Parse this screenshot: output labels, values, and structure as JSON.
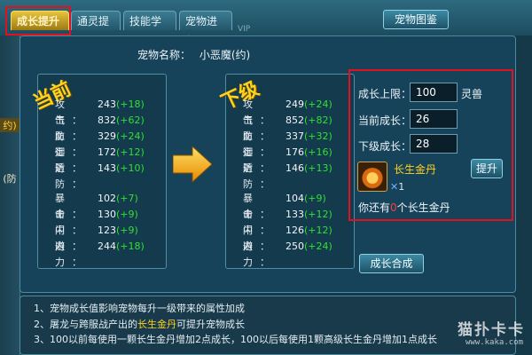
{
  "tabs": [
    {
      "label": "成长提升",
      "active": true
    },
    {
      "label": "通灵提升",
      "active": false
    },
    {
      "label": "技能学习",
      "active": false
    },
    {
      "label": "宠物进化",
      "active": false
    }
  ],
  "header": {
    "atlas_button": "宠物图鉴",
    "vip_text": "VIP"
  },
  "sidebar": {
    "items": [
      "",
      "",
      "约)",
      "",
      "",
      "(防"
    ]
  },
  "pet": {
    "name_label": "宠物名称：",
    "name": "小恶魔(约)"
  },
  "current": {
    "badge": "当前",
    "stats": [
      {
        "name": "攻击：",
        "value": "243",
        "bonus": "(+18)"
      },
      {
        "name": "气血：",
        "value": "832",
        "bonus": "(+62)"
      },
      {
        "name": "防御：",
        "value": "329",
        "bonus": "(+24)"
      },
      {
        "name": "远防：",
        "value": "172",
        "bonus": "(+12)"
      },
      {
        "name": "近防：",
        "value": "143",
        "bonus": "(+10)"
      },
      {
        "name": "暴击：",
        "value": "102",
        "bonus": "(+7)"
      },
      {
        "name": "命中：",
        "value": "130",
        "bonus": "(+9)"
      },
      {
        "name": "闪避：",
        "value": "123",
        "bonus": "(+9)"
      },
      {
        "name": "内力：",
        "value": "244",
        "bonus": "(+18)"
      }
    ]
  },
  "next": {
    "badge": "下级",
    "stats": [
      {
        "name": "攻击：",
        "value": "249",
        "bonus": "(+24)"
      },
      {
        "name": "气血：",
        "value": "852",
        "bonus": "(+82)"
      },
      {
        "name": "防御：",
        "value": "337",
        "bonus": "(+32)"
      },
      {
        "name": "远防：",
        "value": "176",
        "bonus": "(+16)"
      },
      {
        "name": "近防：",
        "value": "146",
        "bonus": "(+13)"
      },
      {
        "name": "暴击：",
        "value": "104",
        "bonus": "(+9)"
      },
      {
        "name": "命中：",
        "value": "133",
        "bonus": "(+12)"
      },
      {
        "name": "闪避：",
        "value": "126",
        "bonus": "(+12)"
      },
      {
        "name": "内力：",
        "value": "250",
        "bonus": "(+24)"
      }
    ]
  },
  "growth": {
    "limit_label": "成长上限：",
    "limit_value": "100",
    "limit_unit": "灵兽",
    "current_label": "当前成长：",
    "current_value": "26",
    "next_label": "下级成长：",
    "next_value": "28",
    "item_name": "长生金丹",
    "item_qty": "1",
    "qty_mark": "✕",
    "upgrade_button": "提升",
    "remain_prefix": "你还有",
    "remain_count": "0",
    "remain_suffix": "个长生金丹"
  },
  "combine_button": "成长合成",
  "info": {
    "line1": "1、宠物成长值影响宠物每升一级带来的属性加成",
    "line2_a": "2、屠龙与跨服战产出的",
    "line2_hl": "长生金丹",
    "line2_b": "可提升宠物成长",
    "line3": "3、100以前每使用一颗长生金丹增加2点成长，100以后每使用1颗高级长生金丹增加1点成长"
  },
  "watermark": {
    "main": "猫扑卡卡",
    "url": "www.kaka.com"
  },
  "colors": {
    "bonus": "#2fe12f",
    "gold": "#ffd21e",
    "highlight_red": "#e0121f"
  }
}
